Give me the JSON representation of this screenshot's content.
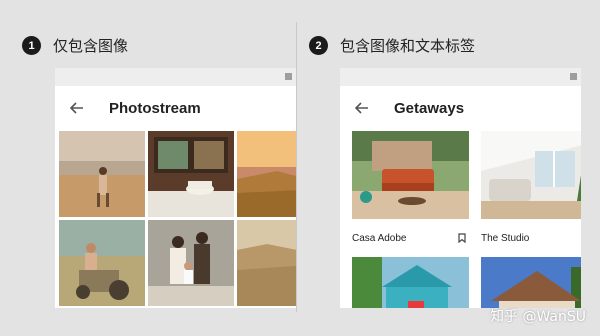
{
  "left": {
    "step_number": "1",
    "heading": "仅包含图像",
    "app_title": "Photostream",
    "photos": [
      "beach-portrait",
      "kitchen-cake",
      "coastal-sunset",
      "men-with-tractor",
      "family-portrait",
      "landscape-vista"
    ]
  },
  "right": {
    "step_number": "2",
    "heading": "包含图像和文本标签",
    "app_title": "Getaways",
    "cards": [
      {
        "label": "Casa Adobe",
        "bookmark": true
      },
      {
        "label": "The Studio",
        "bookmark": false
      },
      {
        "label": "",
        "bookmark": false
      },
      {
        "label": "",
        "bookmark": false
      }
    ]
  },
  "watermark": "知乎 @WanSU",
  "colors": {
    "background": "#e3e3e3",
    "badge": "#1b1b1b",
    "status_bar": "#eeeeee"
  }
}
